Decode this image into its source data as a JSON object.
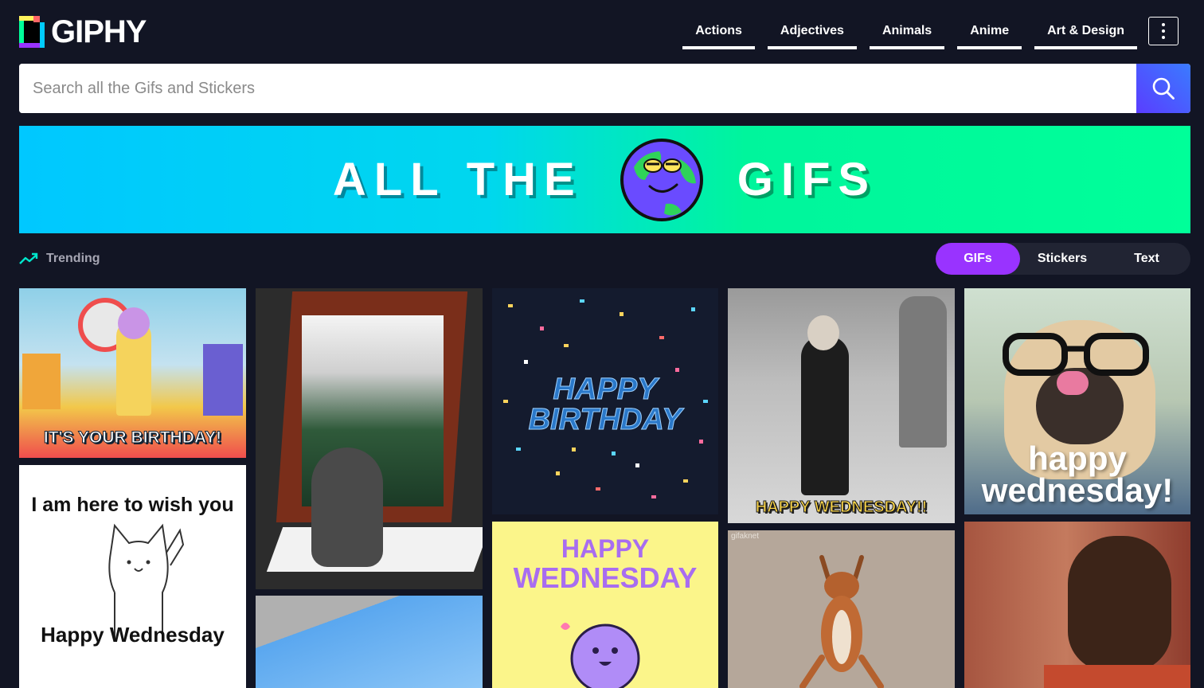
{
  "header": {
    "logo_text": "GIPHY",
    "nav": [
      "Actions",
      "Adjectives",
      "Animals",
      "Anime",
      "Art & Design"
    ]
  },
  "search": {
    "placeholder": "Search all the Gifs and Stickers"
  },
  "banner": {
    "left_text": "ALL THE",
    "right_text": "GIFS"
  },
  "trending": {
    "label": "Trending"
  },
  "toggle": {
    "options": [
      "GIFs",
      "Stickers",
      "Text"
    ],
    "active": "GIFs"
  },
  "gifs": {
    "birthday_kid_caption": "IT'S YOUR BIRTHDAY!",
    "happy_birthday_line1": "HAPPY",
    "happy_birthday_line2": "BIRTHDAY",
    "wednesday_caption": "HAPPY WEDNESDAY!!",
    "pug_line1": "happy",
    "pug_line2": "wednesday!",
    "cat_line1": "I am here to wish you",
    "cat_line2": "Happy Wednesday",
    "purple_line1": "HAPPY",
    "purple_line2": "WEDNESDAY",
    "squirrel_watermark": "gifaknet"
  },
  "colors": {
    "background": "#121524",
    "accent_purple": "#9933ff",
    "banner_blue": "#00c8ff",
    "banner_green": "#00ff99"
  }
}
